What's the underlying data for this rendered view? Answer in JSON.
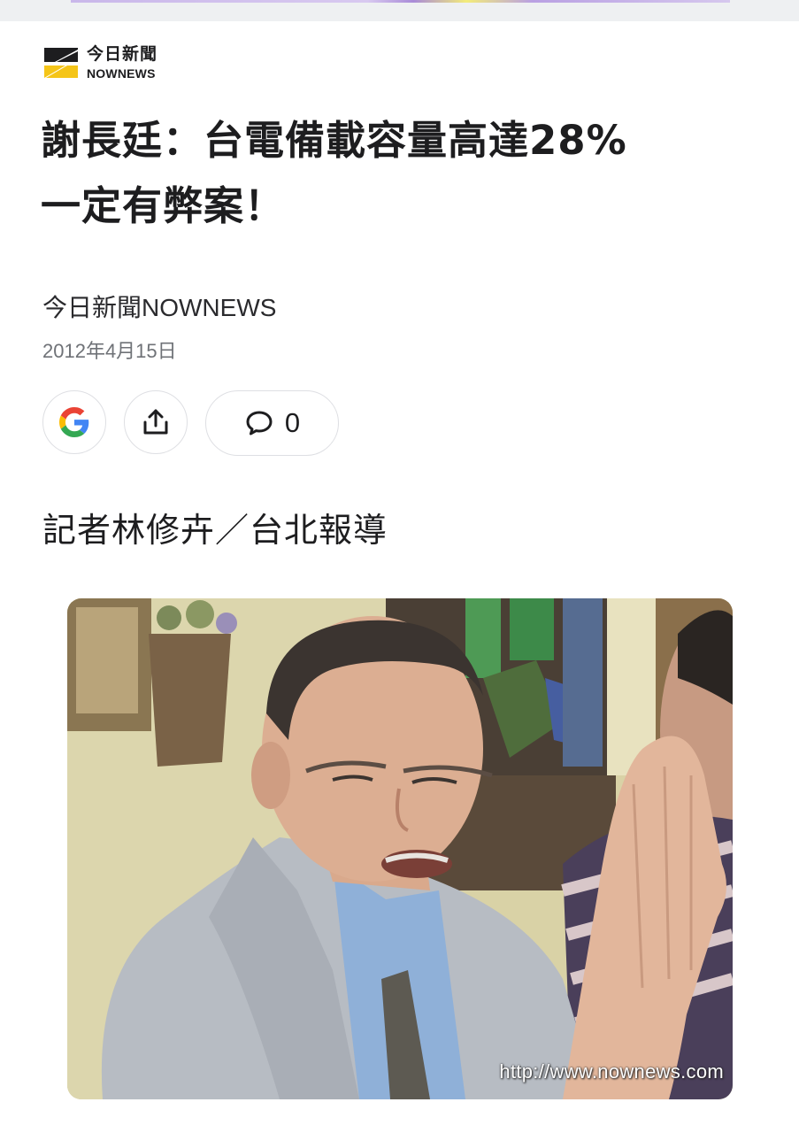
{
  "publisher_logo": {
    "name_zh": "今日新聞",
    "name_en": "NOWNEWS",
    "colors": {
      "mark_dark": "#1d1d1f",
      "mark_yellow": "#f5c518"
    }
  },
  "article": {
    "headline_line1": "謝長廷：台電備載容量高達28%",
    "headline_line2": "一定有弊案！",
    "publisher": "今日新聞NOWNEWS",
    "date": "2012年4月15日",
    "reporter_line": "記者林修卉／台北報導"
  },
  "actions": {
    "google_icon": "google-icon",
    "share_icon": "share-upload-icon",
    "comment_icon": "comment-bubble-icon",
    "comment_count": "0"
  },
  "photo": {
    "watermark": "http://www.nownews.com"
  }
}
